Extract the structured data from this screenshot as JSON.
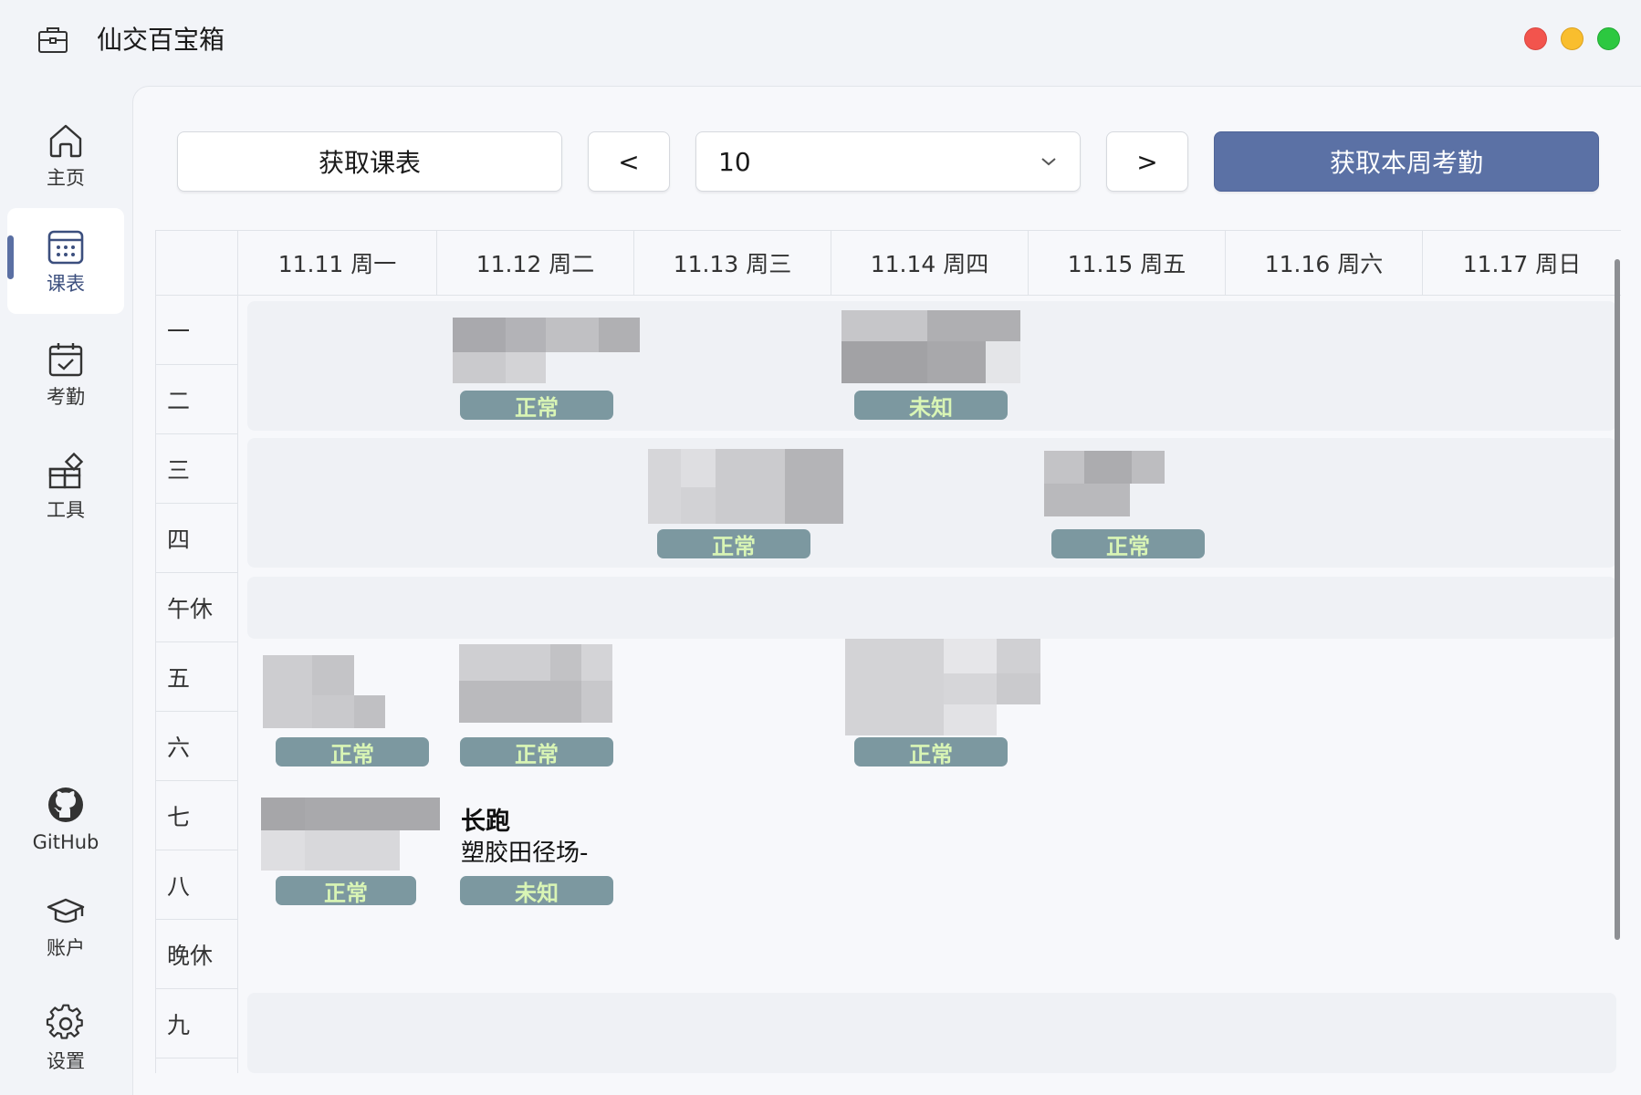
{
  "app": {
    "title": "仙交百宝箱",
    "icon": "briefcase-icon"
  },
  "sidebar": {
    "items": [
      {
        "label": "主页",
        "icon": "home-icon",
        "active": false
      },
      {
        "label": "课表",
        "icon": "calendar-grid-icon",
        "active": true
      },
      {
        "label": "考勤",
        "icon": "calendar-check-icon",
        "active": false
      },
      {
        "label": "工具",
        "icon": "tools-icon",
        "active": false
      },
      {
        "label": "GitHub",
        "icon": "github-icon",
        "active": false
      },
      {
        "label": "账户",
        "icon": "graduation-cap-icon",
        "active": false
      },
      {
        "label": "设置",
        "icon": "gear-icon",
        "active": false
      }
    ]
  },
  "toolbar": {
    "fetch_label": "获取课表",
    "prev_label": "<",
    "week_value": "10",
    "next_label": ">",
    "attendance_label": "获取本周考勤"
  },
  "timetable": {
    "days": [
      "11.11 周一",
      "11.12 周二",
      "11.13 周三",
      "11.14 周四",
      "11.15 周五",
      "11.16 周六",
      "11.17 周日"
    ],
    "periods": [
      "一",
      "二",
      "三",
      "四",
      "午休",
      "五",
      "六",
      "七",
      "八",
      "晚休",
      "九"
    ],
    "courses": [
      {
        "day": 2,
        "status": "正常"
      },
      {
        "day": 4,
        "status": "未知"
      },
      {
        "day": 3,
        "status": "正常"
      },
      {
        "day": 5,
        "status": "正常"
      },
      {
        "day": 1,
        "status": "正常"
      },
      {
        "day": 2,
        "status": "正常"
      },
      {
        "day": 4,
        "status": "正常"
      },
      {
        "day": 1,
        "status": "正常"
      },
      {
        "day": 2,
        "title": "长跑",
        "location": "塑胶田径场-",
        "status": "未知"
      }
    ]
  },
  "colors": {
    "accent": "#5b71a5",
    "badge_bg": "#7c98a0",
    "badge_text": "#d9f5b5"
  }
}
